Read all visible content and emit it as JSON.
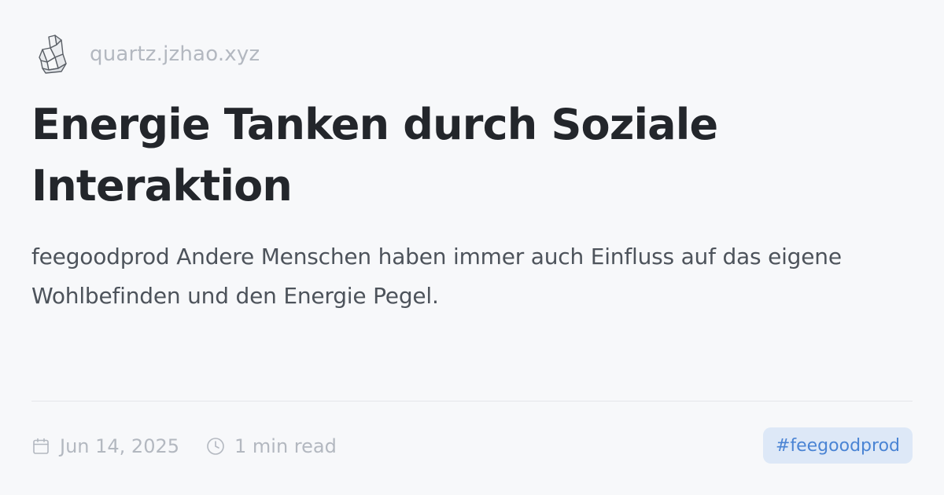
{
  "site": {
    "logo_icon": "crystal-logo-icon",
    "domain": "quartz.jzhao.xyz"
  },
  "article": {
    "title": "Energie Tanken durch Soziale Interaktion",
    "description": "feegoodprod Andere Menschen haben immer auch Einfluss auf das eigene Wohlbefinden und den Energie Pegel."
  },
  "meta": {
    "date_icon": "calendar-icon",
    "date": "Jun 14, 2025",
    "read_icon": "clock-icon",
    "reading_time": "1 min read"
  },
  "tags": [
    "#feegoodprod"
  ],
  "colors": {
    "background": "#f7f8fa",
    "title": "#23262b",
    "text": "#4d535b",
    "muted": "#b3b8c0",
    "tag_background": "#dde8f7",
    "tag_text": "#4a84d4"
  }
}
